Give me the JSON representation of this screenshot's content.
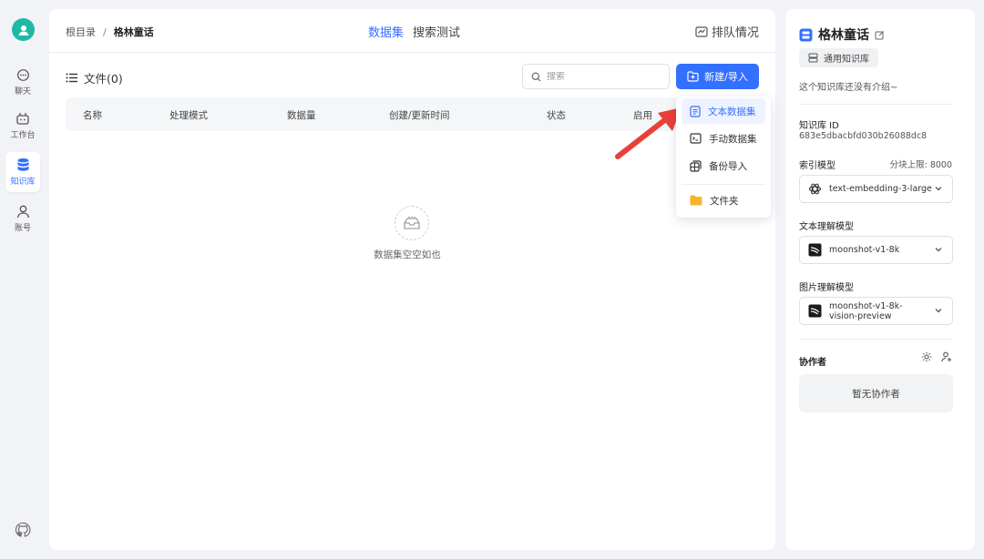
{
  "nav": {
    "items": [
      {
        "label": "聊天",
        "icon": "chat-icon"
      },
      {
        "label": "工作台",
        "icon": "robot-icon"
      },
      {
        "label": "知识库",
        "icon": "database-icon"
      },
      {
        "label": "账号",
        "icon": "user-icon"
      }
    ],
    "accent": "#3370ff"
  },
  "topbar": {
    "breadcrumb": {
      "root": "根目录",
      "separator": "/",
      "current": "格林童话"
    },
    "tabs": [
      {
        "label": "数据集",
        "active": true
      },
      {
        "label": "搜索测试",
        "active": false
      }
    ],
    "queue_label": "排队情况"
  },
  "files": {
    "title": "文件(0)",
    "search_placeholder": "搜索",
    "new_button": "新建/导入",
    "columns": [
      "名称",
      "处理模式",
      "数据量",
      "创建/更新时间",
      "状态",
      "启用"
    ],
    "empty_text": "数据集空空如也"
  },
  "dropdown": {
    "items": [
      {
        "label": "文本数据集",
        "icon": "document-icon"
      },
      {
        "label": "手动数据集",
        "icon": "terminal-icon"
      },
      {
        "label": "备份导入",
        "icon": "backup-icon"
      },
      {
        "label": "文件夹",
        "icon": "folder-icon"
      }
    ]
  },
  "side": {
    "title": "格林童话",
    "tag": "通用知识库",
    "intro": "这个知识库还没有介绍~",
    "id_label": "知识库 ID",
    "id_value": "683e5dbacbfd030b26088dc8",
    "index_model_label": "索引模型",
    "chunk_limit": "分块上限: 8000",
    "index_model": "text-embedding-3-large",
    "text_model_label": "文本理解模型",
    "text_model": "moonshot-v1-8k",
    "image_model_label": "图片理解模型",
    "image_model": "moonshot-v1-8k-vision-preview",
    "collab_label": "协作者",
    "collab_empty": "暂无协作者"
  }
}
